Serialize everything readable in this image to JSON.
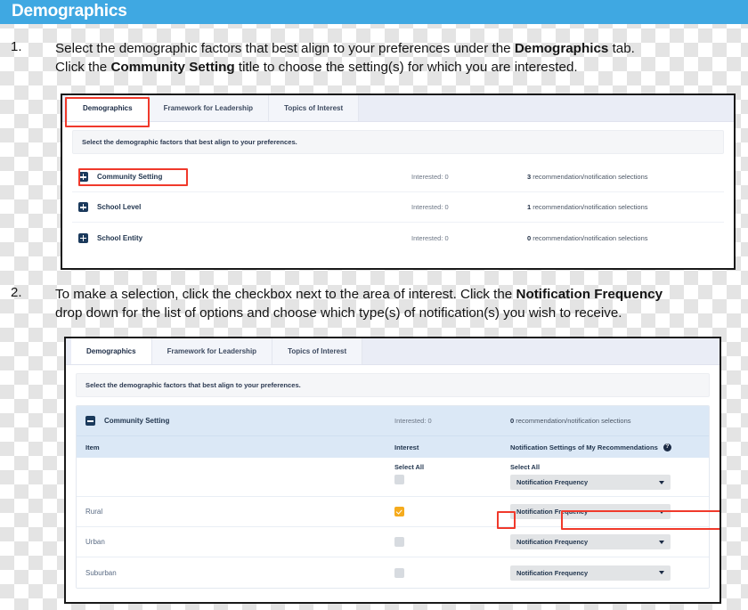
{
  "banner": {
    "title": "Demographics",
    "color": "#3fa8e2"
  },
  "steps": [
    {
      "number": "1.",
      "line1_a": "Select the demographic factors that best align to your preferences under the ",
      "line1_b": "Demographics",
      "line1_c": " tab.",
      "line2_a": "Click the ",
      "line2_b": "Community Setting",
      "line2_c": " title to choose the setting(s) for which you are interested."
    },
    {
      "number": "2.",
      "line1_a": "To make a selection, click the checkbox next to the area of interest. Click the ",
      "line1_b": "Notification Frequency",
      "line1_c": "",
      "line2_a": "drop down for the list of options and choose which type(s) of notification(s) you wish to receive.",
      "line2_b": "",
      "line2_c": ""
    }
  ],
  "screenshot1": {
    "tabs": [
      {
        "label": "Demographics",
        "active": true
      },
      {
        "label": "Framework for Leadership",
        "active": false
      },
      {
        "label": "Topics of Interest",
        "active": false
      }
    ],
    "intro": "Select the demographic factors that best align to your preferences.",
    "rows": [
      {
        "icon": "plus-square-icon",
        "title": "Community Setting",
        "interested": "Interested: 0",
        "count": "3",
        "selections_text": " recommendation/notification selections"
      },
      {
        "icon": "plus-square-icon",
        "title": "School Level",
        "interested": "Interested: 0",
        "count": "1",
        "selections_text": " recommendation/notification selections"
      },
      {
        "icon": "plus-square-icon",
        "title": "School Entity",
        "interested": "Interested: 0",
        "count": "0",
        "selections_text": " recommendation/notification selections"
      }
    ]
  },
  "screenshot2": {
    "tabs": [
      {
        "label": "Demographics",
        "active": true
      },
      {
        "label": "Framework for Leadership",
        "active": false
      },
      {
        "label": "Topics of Interest",
        "active": false
      }
    ],
    "intro": "Select the demographic factors that best align to your preferences.",
    "expanded": {
      "icon": "minus-square-icon",
      "title": "Community Setting",
      "interested": "Interested: 0",
      "count": "0",
      "selections_text": " recommendation/notification selections",
      "columns": {
        "item": "Item",
        "interest": "Interest",
        "notification": "Notification Settings of My Recommendations",
        "help_glyph": "?"
      },
      "select_all": {
        "interest_label": "Select All",
        "notification_label": "Select All",
        "dropdown_value": "Notification Frequency",
        "checked": false
      },
      "rows": [
        {
          "label": "Rural",
          "checked": true,
          "dropdown_value": "Notification Frequency"
        },
        {
          "label": "Urban",
          "checked": false,
          "dropdown_value": "Notification Frequency"
        },
        {
          "label": "Suburban",
          "checked": false,
          "dropdown_value": "Notification Frequency"
        }
      ]
    }
  },
  "annotations": {
    "highlight_color": "#f0392b",
    "boxes": [
      "demographics-tab-highlight",
      "community-setting-title-highlight",
      "rural-checkbox-highlight",
      "rural-notification-dropdown-highlight"
    ]
  }
}
